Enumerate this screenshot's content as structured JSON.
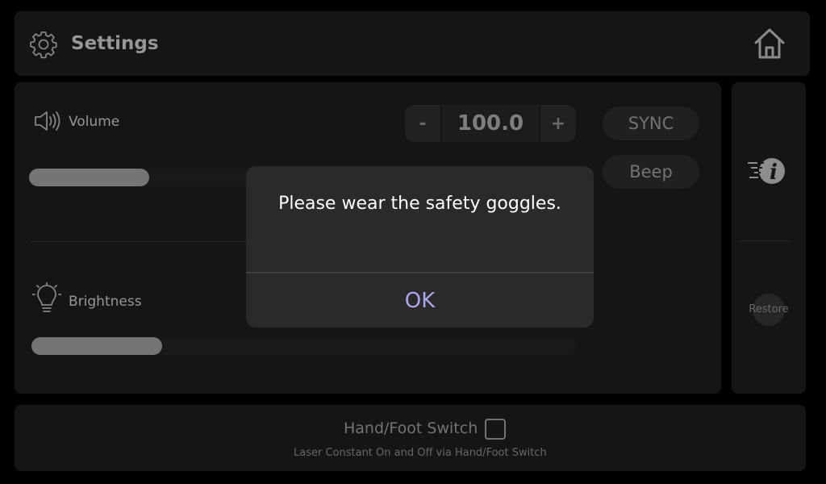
{
  "header": {
    "title": "Settings",
    "settings_icon": "gear-icon",
    "home_icon": "home-icon"
  },
  "volume": {
    "label": "Volume",
    "icon": "speaker-icon",
    "value": "100.0",
    "decrement_label": "-",
    "increment_label": "+",
    "slider_level": 0.22
  },
  "buttons": {
    "sync_label": "SYNC",
    "beep_label": "Beep"
  },
  "brightness": {
    "label": "Brightness",
    "icon": "lightbulb-icon",
    "slider_level": 0.24
  },
  "side": {
    "info_icon": "info-icon",
    "restore_label": "Restore"
  },
  "footer": {
    "hand_foot_label": "Hand/Foot Switch",
    "hand_foot_checked": false,
    "description": "Laser Constant On  and Off via Hand/Foot Switch"
  },
  "dialog": {
    "message": "Please wear the safety goggles.",
    "ok_label": "OK"
  },
  "colors": {
    "background": "#000000",
    "panel": "#1d1d1d",
    "dialog": "#2a2a2a",
    "accent_ok": "#a9a6ee",
    "slider_fill": "#9c9c9c"
  }
}
